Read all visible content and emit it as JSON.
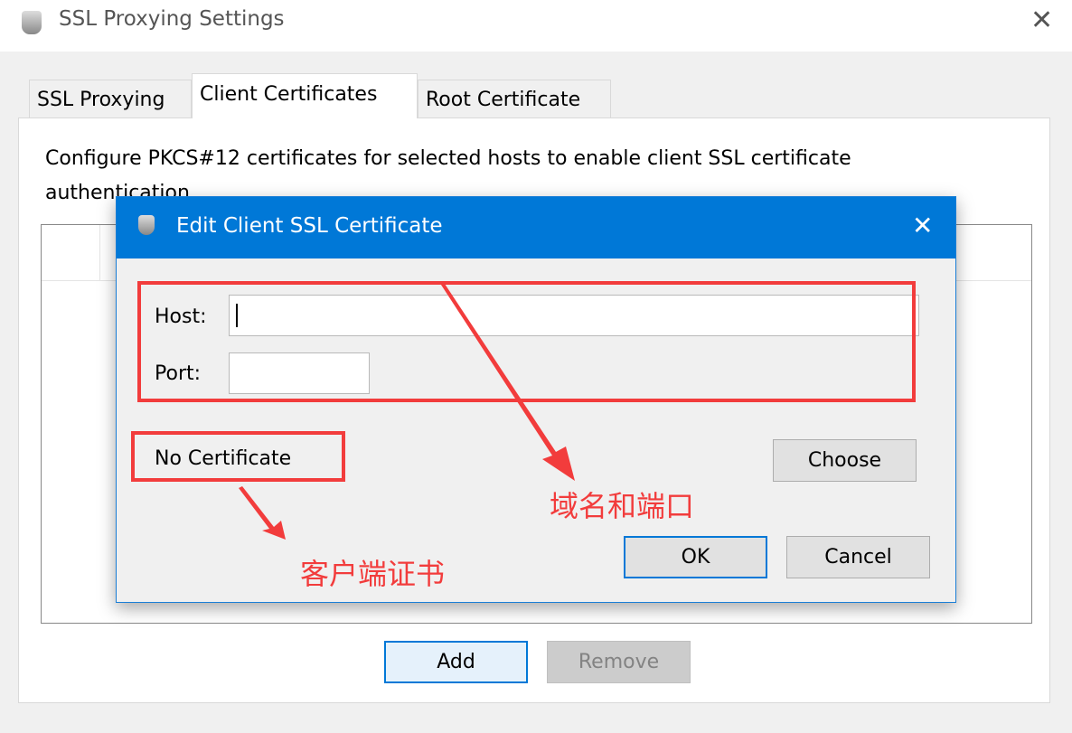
{
  "window": {
    "title": "SSL Proxying Settings",
    "icon": "charles-jug-icon",
    "close": "✕"
  },
  "tabs": [
    {
      "label": "SSL Proxying"
    },
    {
      "label": "Client Certificates",
      "active": true
    },
    {
      "label": "Root Certificate"
    }
  ],
  "panel": {
    "description": "Configure PKCS#12 certificates for selected hosts to enable client SSL certificate authentication."
  },
  "buttons": {
    "add": "Add",
    "remove": "Remove"
  },
  "dialog": {
    "title": "Edit Client SSL Certificate",
    "close": "✕",
    "host_label": "Host:",
    "host_value": "",
    "port_label": "Port:",
    "port_value": "",
    "certificate_status": "No Certificate",
    "choose": "Choose",
    "ok": "OK",
    "cancel": "Cancel"
  },
  "annotations": {
    "host_port": "域名和端口",
    "client_cert": "客户端证书",
    "color": "#f23c3c"
  },
  "colors": {
    "accent": "#0078d7"
  }
}
